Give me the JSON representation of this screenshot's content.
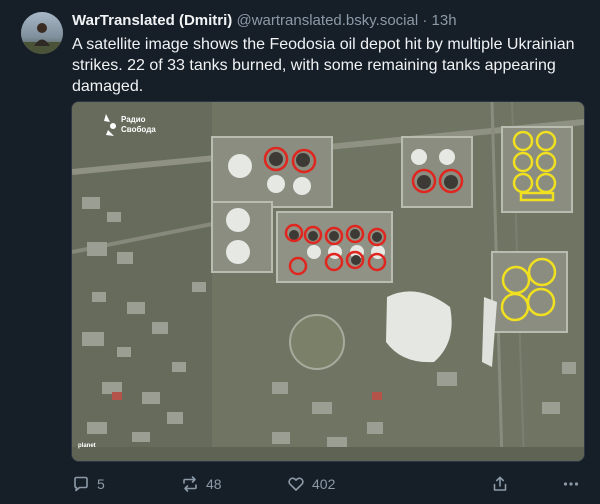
{
  "post": {
    "display_name": "WarTranslated (Dmitri)",
    "handle": "@wartranslated.bsky.social",
    "separator": "·",
    "timestamp": "13h",
    "text_lines": [
      "A satellite image shows the Feodosia oil depot hit by multiple Ukrainian",
      "strikes. 22 of 33 tanks burned, with some remaining tanks appearing",
      "damaged."
    ]
  },
  "media": {
    "watermark_line1": "Радио",
    "watermark_line2": "Свобода",
    "credit": "planet",
    "marker_colors": {
      "burned": "#e0261f",
      "damaged": "#f0e020"
    }
  },
  "actions": {
    "reply_count": "5",
    "repost_count": "48",
    "like_count": "402"
  },
  "colors": {
    "background": "#161e27",
    "text_primary": "#f1f3f5",
    "text_secondary": "#8c9aa8"
  }
}
